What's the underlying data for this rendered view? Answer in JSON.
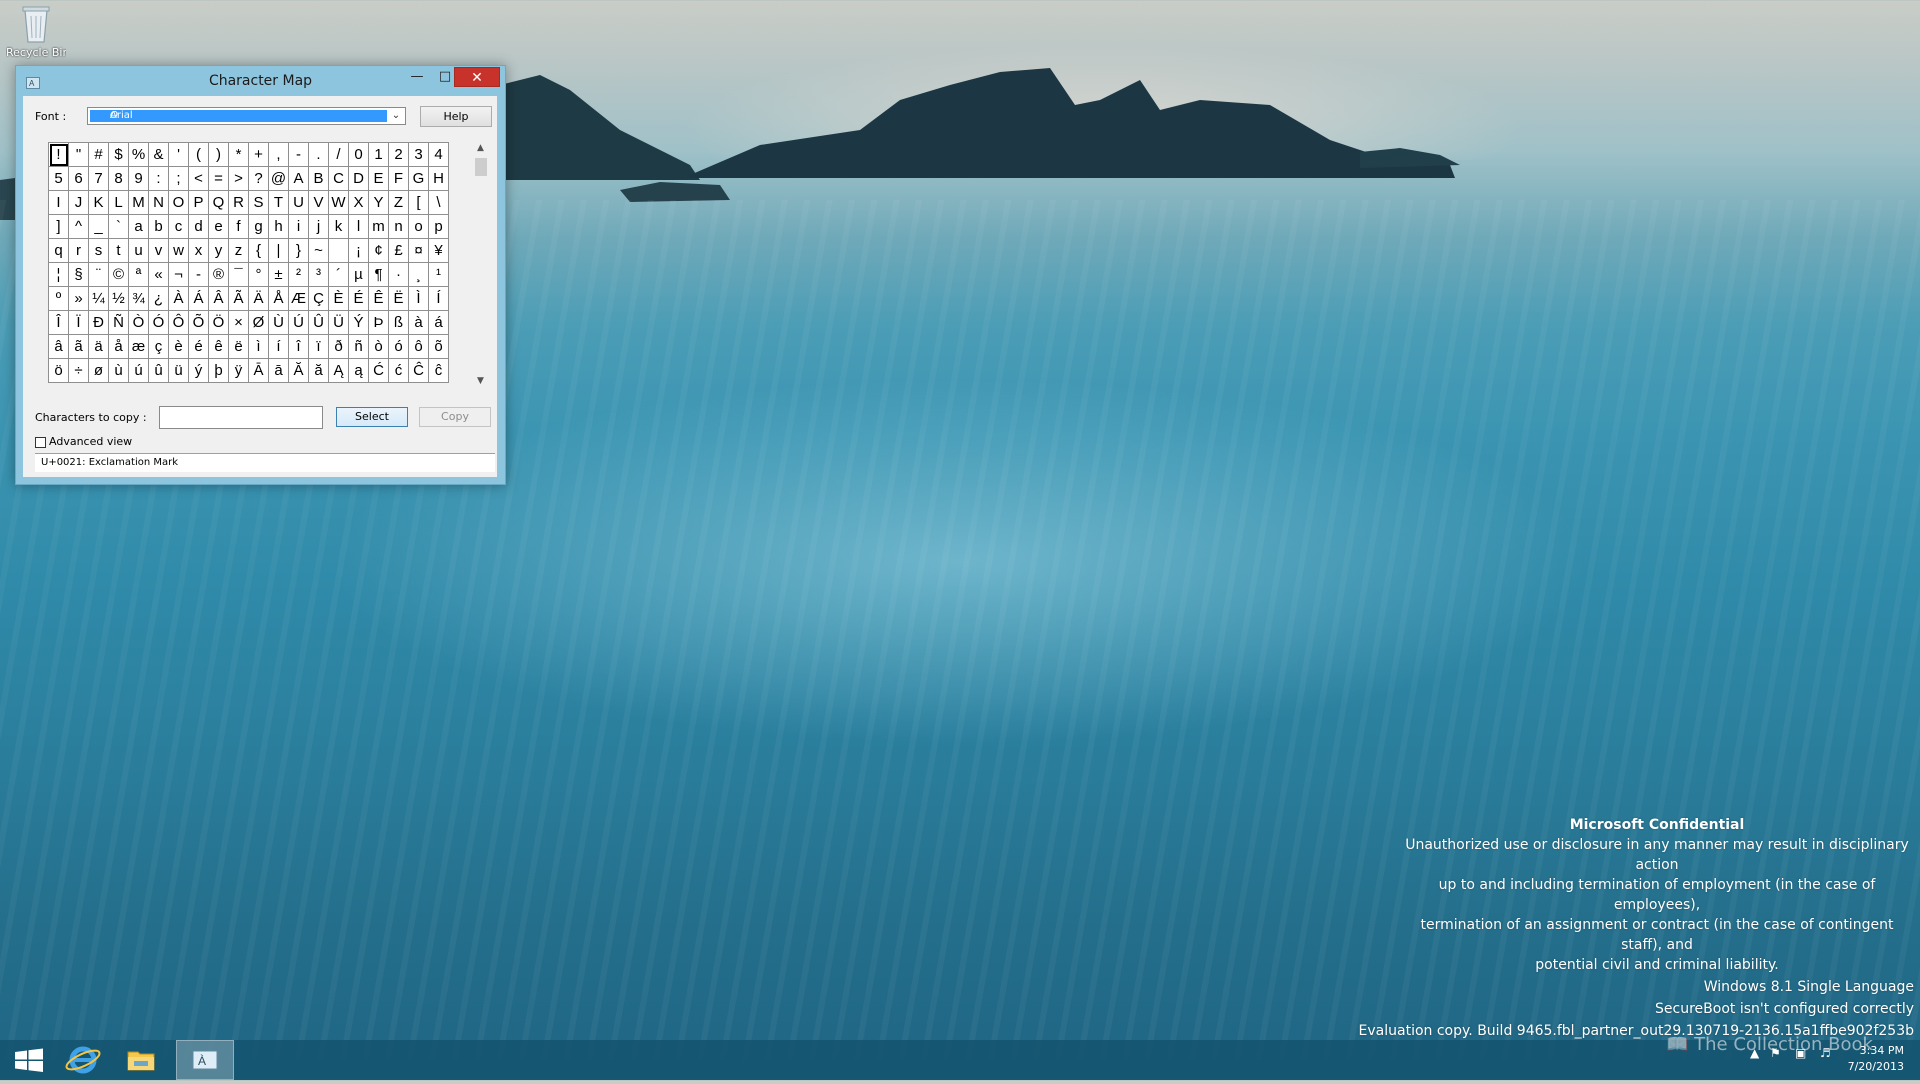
{
  "desktop": {
    "recycle_bin_label": "Recycle Bin"
  },
  "window": {
    "title": "Character Map",
    "font_label": "Font :",
    "font_value": "Arial",
    "help_label": "Help",
    "grid_rows": [
      [
        "!",
        "\"",
        "#",
        "$",
        "%",
        "&",
        "'",
        "(",
        ")",
        "*",
        "+",
        ",",
        "-",
        ".",
        "/",
        "0",
        "1",
        "2",
        "3",
        "4"
      ],
      [
        "5",
        "6",
        "7",
        "8",
        "9",
        ":",
        ";",
        "<",
        "=",
        ">",
        "?",
        "@",
        "A",
        "B",
        "C",
        "D",
        "E",
        "F",
        "G",
        "H"
      ],
      [
        "I",
        "J",
        "K",
        "L",
        "M",
        "N",
        "O",
        "P",
        "Q",
        "R",
        "S",
        "T",
        "U",
        "V",
        "W",
        "X",
        "Y",
        "Z",
        "[",
        "\\"
      ],
      [
        "]",
        "^",
        "_",
        "`",
        "a",
        "b",
        "c",
        "d",
        "e",
        "f",
        "g",
        "h",
        "i",
        "j",
        "k",
        "l",
        "m",
        "n",
        "o",
        "p"
      ],
      [
        "q",
        "r",
        "s",
        "t",
        "u",
        "v",
        "w",
        "x",
        "y",
        "z",
        "{",
        "|",
        "}",
        "~",
        " ",
        "¡",
        "¢",
        "£",
        "¤",
        "¥"
      ],
      [
        "¦",
        "§",
        "¨",
        "©",
        "ª",
        "«",
        "¬",
        "-",
        "®",
        "¯",
        "°",
        "±",
        "²",
        "³",
        "´",
        "µ",
        "¶",
        "·",
        "¸",
        "¹"
      ],
      [
        "º",
        "»",
        "¼",
        "½",
        "¾",
        "¿",
        "À",
        "Á",
        "Â",
        "Ã",
        "Ä",
        "Å",
        "Æ",
        "Ç",
        "È",
        "É",
        "Ê",
        "Ë",
        "Ì",
        "Í"
      ],
      [
        "Î",
        "Ï",
        "Ð",
        "Ñ",
        "Ò",
        "Ó",
        "Ô",
        "Õ",
        "Ö",
        "×",
        "Ø",
        "Ù",
        "Ú",
        "Û",
        "Ü",
        "Ý",
        "Þ",
        "ß",
        "à",
        "á"
      ],
      [
        "â",
        "ã",
        "ä",
        "å",
        "æ",
        "ç",
        "è",
        "é",
        "ê",
        "ë",
        "ì",
        "í",
        "î",
        "ï",
        "ð",
        "ñ",
        "ò",
        "ó",
        "ô",
        "õ"
      ],
      [
        "ö",
        "÷",
        "ø",
        "ù",
        "ú",
        "û",
        "ü",
        "ý",
        "þ",
        "ÿ",
        "Ā",
        "ā",
        "Ă",
        "ă",
        "Ą",
        "ą",
        "Ć",
        "ć",
        "Ĉ",
        "ĉ"
      ]
    ],
    "chars_to_copy_label": "Characters to copy :",
    "chars_to_copy_value": "",
    "select_label": "Select",
    "copy_label": "Copy",
    "advanced_view_label": "Advanced view",
    "status_text": "U+0021: Exclamation Mark"
  },
  "watermark": {
    "title": "Microsoft Confidential",
    "lines": [
      "Unauthorized use or disclosure in any manner may result in disciplinary action",
      "up to and including termination of employment (in the case of employees),",
      "termination of an assignment or contract (in the case of contingent staff), and",
      "potential civil and criminal liability."
    ]
  },
  "build": {
    "line1": "Windows 8.1 Single Language",
    "line2": "SecureBoot isn't configured correctly",
    "line3": "Evaluation copy. Build 9465.fbl_partner_out29.130719-2136.15a1ffbe902f253b"
  },
  "taskbar": {
    "items": [
      "start-icon",
      "internet-explorer-icon",
      "file-explorer-icon",
      "character-map-icon"
    ],
    "time": "3:34 PM",
    "date": "7/20/2013",
    "collection_text": "The Collection Book"
  },
  "colors": {
    "close_button": "#c7332b",
    "window_frame": "#8ec5de",
    "selection": "#3399ff"
  }
}
